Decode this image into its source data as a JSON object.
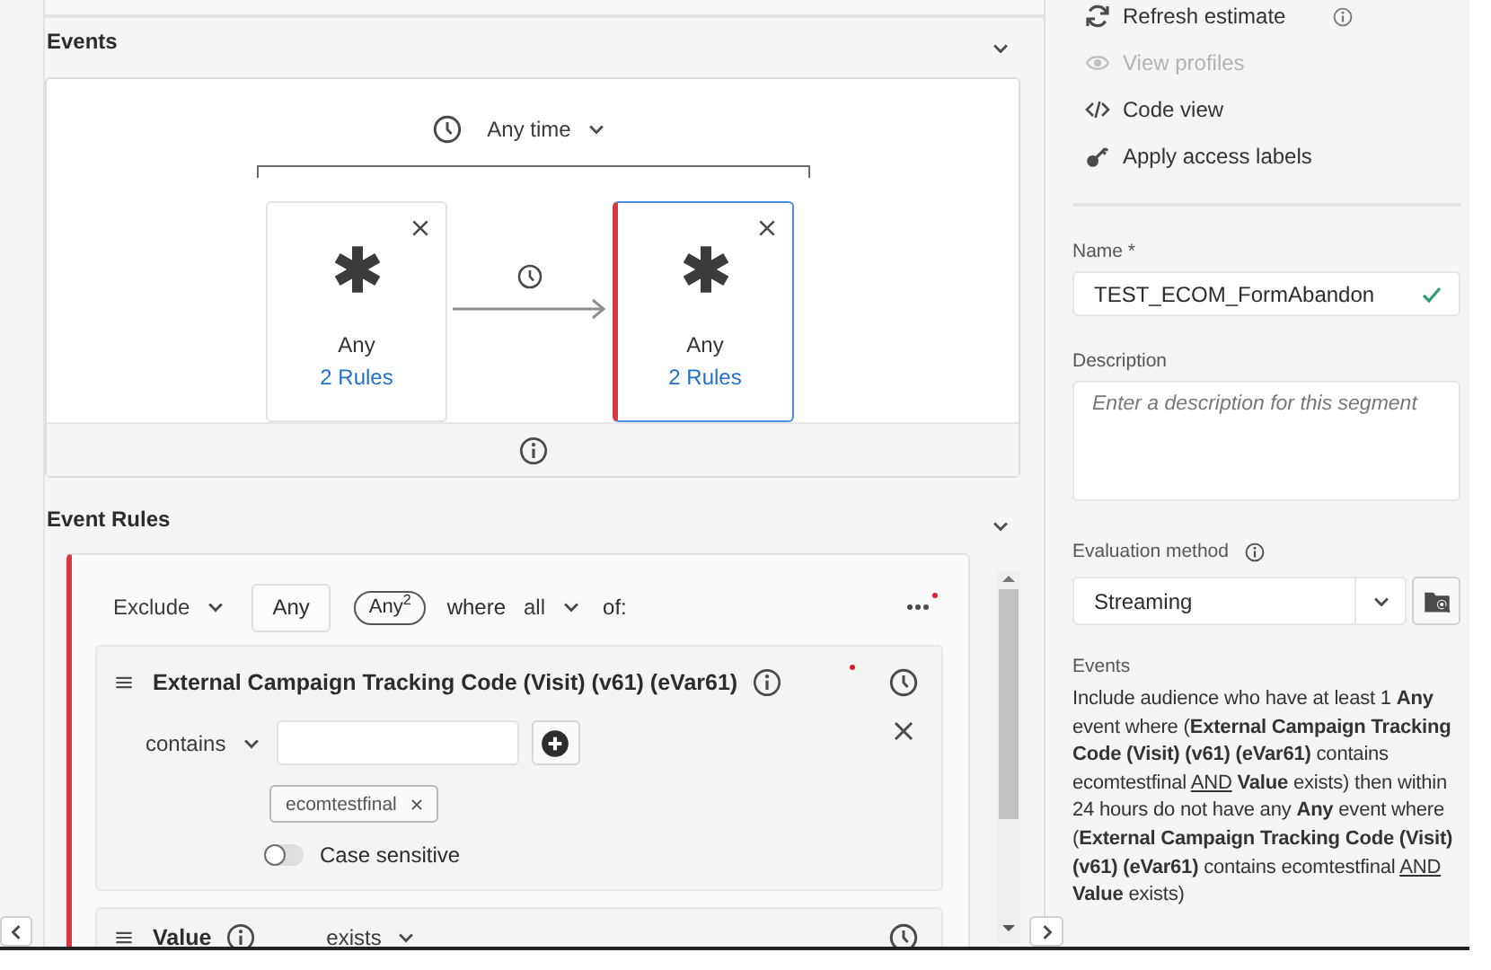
{
  "events_section": {
    "title": "Events",
    "expanded": true,
    "time_filter": "Any time",
    "nodes": [
      {
        "label": "Any",
        "rules": "2 Rules",
        "selected": false
      },
      {
        "label": "Any",
        "rules": "2 Rules",
        "selected": true
      }
    ]
  },
  "event_rules": {
    "title": "Event Rules",
    "expanded": true,
    "header": {
      "mode": "Exclude",
      "event": "Any",
      "badge": "Any$^{2}$",
      "where": "where",
      "quantifier": "all",
      "of": "of:"
    },
    "rules": [
      {
        "kind": "value_list",
        "title": "External Campaign Tracking Code (Visit) (v61) (eVar61)",
        "operator": "contains",
        "tags": [
          "ecomtestfinal"
        ],
        "case_sensitive": false,
        "case_label": "Case sensitive"
      },
      {
        "kind": "exists",
        "title": "Value",
        "operator": "exists"
      }
    ]
  },
  "sidebar": {
    "actions": [
      {
        "label": "Refresh estimate",
        "disabled": false,
        "info": true
      },
      {
        "label": "View profiles",
        "disabled": true,
        "info": false
      },
      {
        "label": "Code view",
        "disabled": false,
        "info": false
      },
      {
        "label": "Apply access labels",
        "disabled": false,
        "info": false
      }
    ],
    "name_label": "Name *",
    "name_value": "TEST_ECOM_FormAbandon",
    "name_valid": true,
    "description_label": "Description",
    "description_placeholder": "Enter a description for this segment",
    "evaluation_label": "Evaluation method",
    "evaluation_value": "Streaming",
    "summary_label": "Events",
    "summary": [
      "Include audience who have at least 1 **Any** event where (**External Campaign Tracking Code (Visit) (v61) (eVar61)** contains ecomtestfinal ",
      "AND",
      " **Value** exists) then within 24 hours do not have any **Any** event where (**External Campaign Tracking Code (Visit) (v61) (eVar61)** contains ecomtestfinal ",
      "AND",
      " **Value** exists)"
    ]
  }
}
